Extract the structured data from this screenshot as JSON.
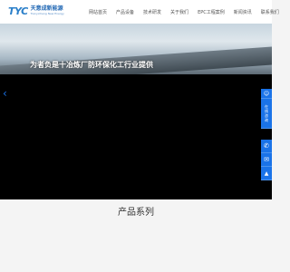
{
  "logo": {
    "mark": "TYC",
    "name_cn": "天意成新能源",
    "name_en": "Tianyicheng New Energy"
  },
  "nav": [
    {
      "label": "网站首页"
    },
    {
      "label": "产品设备"
    },
    {
      "label": "技术研发"
    },
    {
      "label": "关于我们"
    },
    {
      "label": "EPC工程案例"
    },
    {
      "label": "新闻资讯"
    },
    {
      "label": "联系我们"
    }
  ],
  "banner": {
    "slogan": "为者负是十冶炼厂防环保化工行业提供"
  },
  "carousel": {
    "prev_label": "‹"
  },
  "side_tools": {
    "qq": "☺",
    "consult": [
      "在",
      "线",
      "咨",
      "询"
    ],
    "phone": "✆",
    "wechat": "✉",
    "top": "▲"
  },
  "section": {
    "title": "产品系列"
  }
}
